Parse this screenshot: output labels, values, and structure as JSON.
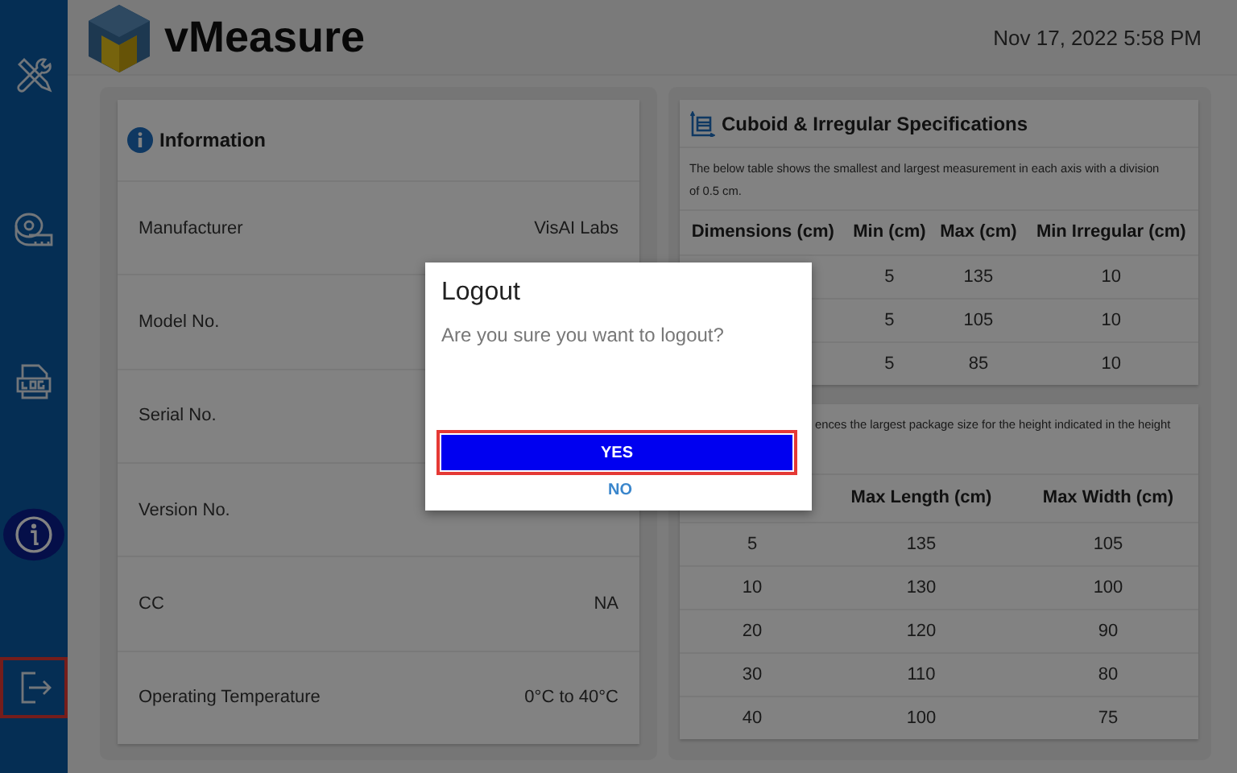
{
  "header": {
    "app_name": "vMeasure",
    "datetime": "Nov 17, 2022 5:58 PM"
  },
  "sidebar": {
    "items": [
      {
        "kind": "tools",
        "selected": false,
        "focused": false
      },
      {
        "kind": "tape",
        "selected": false,
        "focused": false
      },
      {
        "kind": "log",
        "selected": false,
        "focused": false
      },
      {
        "kind": "info",
        "selected": true,
        "focused": false
      },
      {
        "kind": "logout",
        "selected": false,
        "focused": true
      }
    ]
  },
  "information": {
    "title": "Information",
    "rows": [
      {
        "label": "Manufacturer",
        "value": "VisAI Labs"
      },
      {
        "label": "Model No."
      },
      {
        "label": "Serial No."
      },
      {
        "label": "Version No."
      },
      {
        "label": "CC",
        "value": "NA"
      },
      {
        "label": "Operating Temperature",
        "value": "0°C to 40°C"
      }
    ]
  },
  "specifications": {
    "title": "Cuboid & Irregular Specifications",
    "description": "The below table shows the smallest and largest measurement in each axis with a division of 0.5 cm.",
    "columns": [
      "Dimensions (cm)",
      "Min (cm)",
      "Max (cm)",
      "Min Irregular (cm)"
    ],
    "rows": [
      [
        "",
        "5",
        "135",
        "10"
      ],
      [
        "",
        "5",
        "105",
        "10"
      ],
      [
        "",
        "5",
        "85",
        "10"
      ]
    ]
  },
  "package_size": {
    "description": "ences the largest package size for the height indicated in the height",
    "columns": [
      "",
      "Max Length (cm)",
      "Max Width (cm)"
    ],
    "rows": [
      [
        "5",
        "135",
        "105"
      ],
      [
        "10",
        "130",
        "100"
      ],
      [
        "20",
        "120",
        "90"
      ],
      [
        "30",
        "110",
        "80"
      ],
      [
        "40",
        "100",
        "75"
      ]
    ]
  },
  "dialog": {
    "title": "Logout",
    "message": "Are you sure you want to logout?",
    "buttons": [
      {
        "label": "YES",
        "kind": "primary",
        "focused": true
      },
      {
        "label": "NO",
        "kind": "text",
        "focused": false
      }
    ]
  }
}
